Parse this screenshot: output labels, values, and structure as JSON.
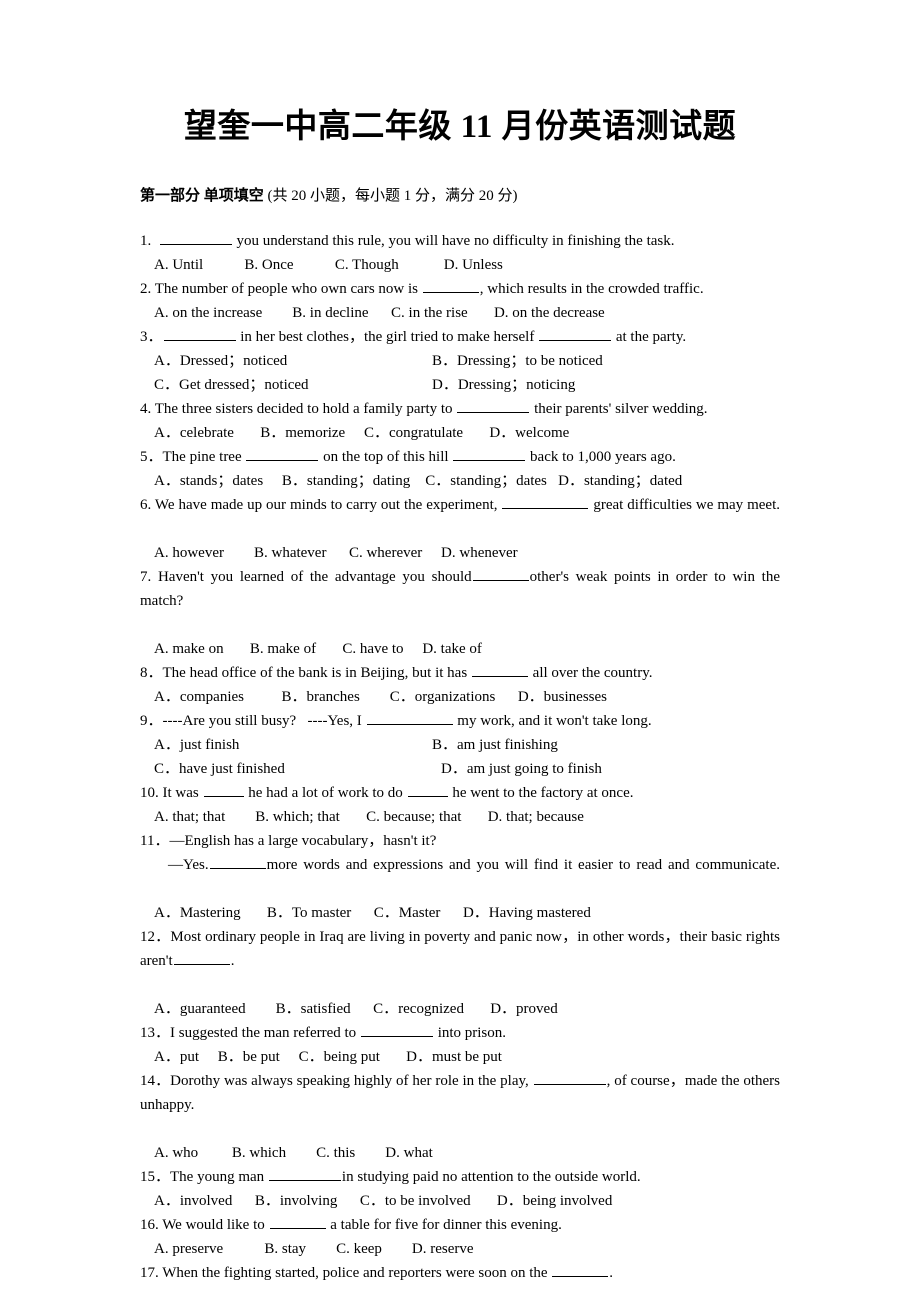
{
  "document": {
    "title": "望奎一中高二年级 11 月份英语测试题",
    "background_color": "#ffffff",
    "text_color": "#000000"
  },
  "section": {
    "label": "第一部分  单项填空",
    "note": " (共 20 小题，每小题 1 分，满分 20 分)"
  },
  "questions": [
    {
      "number": "1.",
      "stem_before": "1.",
      "stem_parts": [
        "1.",
        "  ",
        "BLANK",
        " you understand this rule, you will have no difficulty in finishing the task."
      ],
      "stem_text": "1. ________ you understand this rule, you will have no difficulty in finishing the task.",
      "layout": "row",
      "options": [
        "A. Until",
        "B. Once",
        "C. Though",
        "D. Unless"
      ]
    },
    {
      "number": "2.",
      "stem_text": "2. The number of people who own cars now is _______, which results in the crowded traffic.",
      "layout": "row",
      "options": [
        "A. on the increase",
        "B. in decline",
        "C. in the rise",
        "D. on the decrease"
      ]
    },
    {
      "number": "3.",
      "stem_text": "3．________ in her best clothes，the girl tried to make herself ________ at the party.",
      "layout": "grid",
      "options": [
        "A．Dressed；noticed",
        "B．Dressing；to be noticed",
        "C．Get dressed；noticed",
        "D．Dressing；noticing"
      ]
    },
    {
      "number": "4.",
      "stem_text": "4. The three sisters decided to hold a family party to ________ their parents' silver wedding.",
      "layout": "row",
      "options": [
        "A．celebrate",
        "B．memorize",
        "C．congratulate",
        "D．welcome"
      ]
    },
    {
      "number": "5.",
      "stem_text": "5．The pine tree ________ on the top of this hill ________ back to 1,000 years ago.",
      "layout": "row",
      "options": [
        "A．stands；dates",
        "B．standing；dating",
        "C．standing；dates",
        "D．standing；dated"
      ]
    },
    {
      "number": "6.",
      "stem_text": "6. We have made up our minds to carry out the experiment, _________ great difficulties we may meet.",
      "layout": "row",
      "options": [
        "A. however",
        "B. whatever",
        "C. wherever",
        "D. whenever"
      ]
    },
    {
      "number": "7.",
      "stem_text": "7. Haven't you learned of the advantage you should_______other's weak points in order to win the match?",
      "layout": "row",
      "options": [
        "A. make on",
        "B. make of",
        "C. have to",
        "D. take of"
      ]
    },
    {
      "number": "8.",
      "stem_text": "8．The head office of the bank is in Beijing, but it has _______ all over the country.",
      "layout": "row",
      "options": [
        "A．companies",
        "B．branches",
        "C．organizations",
        "D．businesses"
      ]
    },
    {
      "number": "9.",
      "stem_text": "9．----Are you still busy?   ----Yes, I __________ my work, and it won't take long.",
      "layout": "grid",
      "options": [
        "A．just finish",
        "B．am just finishing",
        "C．have just finished",
        "D．am just going to finish"
      ]
    },
    {
      "number": "10.",
      "stem_text": "10. It was _____ he had a lot of work to do _____ he went to the factory at once.",
      "layout": "row",
      "options": [
        "A. that; that",
        "B. which; that",
        "C. because; that",
        "D. that; because"
      ]
    },
    {
      "number": "11.",
      "stem_line1": "11．—English has a large vocabulary，hasn't it?",
      "stem_line2": "—Yes.________more words and expressions and you will find it easier to read and communicate.",
      "layout": "row",
      "options": [
        "A．Mastering",
        "B．To master",
        "C．Master",
        "D．Having mastered"
      ]
    },
    {
      "number": "12.",
      "stem_text": "12．Most ordinary people in Iraq are living in poverty and panic now，in other words，their basic rights aren't________.",
      "layout": "row",
      "options": [
        "A．guaranteed",
        "B．satisfied",
        "C．recognized",
        "D．proved"
      ]
    },
    {
      "number": "13.",
      "stem_text": "13．I suggested the man referred to ________ into prison.",
      "layout": "row",
      "options": [
        "A．put",
        "B．be put",
        "C．being put",
        "D．must be put"
      ]
    },
    {
      "number": "14.",
      "stem_text": "14．Dorothy was always speaking highly of her role in the play, ________, of course，made the others unhappy.",
      "layout": "row",
      "options": [
        "A. who",
        "B. which",
        "C. this",
        "D. what"
      ]
    },
    {
      "number": "15.",
      "stem_text": "15．The young man ________in studying paid no attention to the outside world.",
      "layout": "row",
      "options": [
        "A．involved",
        "B．involving",
        "C．to be involved",
        "D．being involved"
      ]
    },
    {
      "number": "16.",
      "stem_text": "16. We would like to _______ a table for five for dinner this evening.",
      "layout": "row",
      "options": [
        "A. preserve",
        "B. stay",
        "C. keep",
        "D. reserve"
      ]
    },
    {
      "number": "17.",
      "stem_text": "17. When the fighting started, police and reporters were soon on the _______.",
      "layout": "none",
      "options": []
    }
  ]
}
